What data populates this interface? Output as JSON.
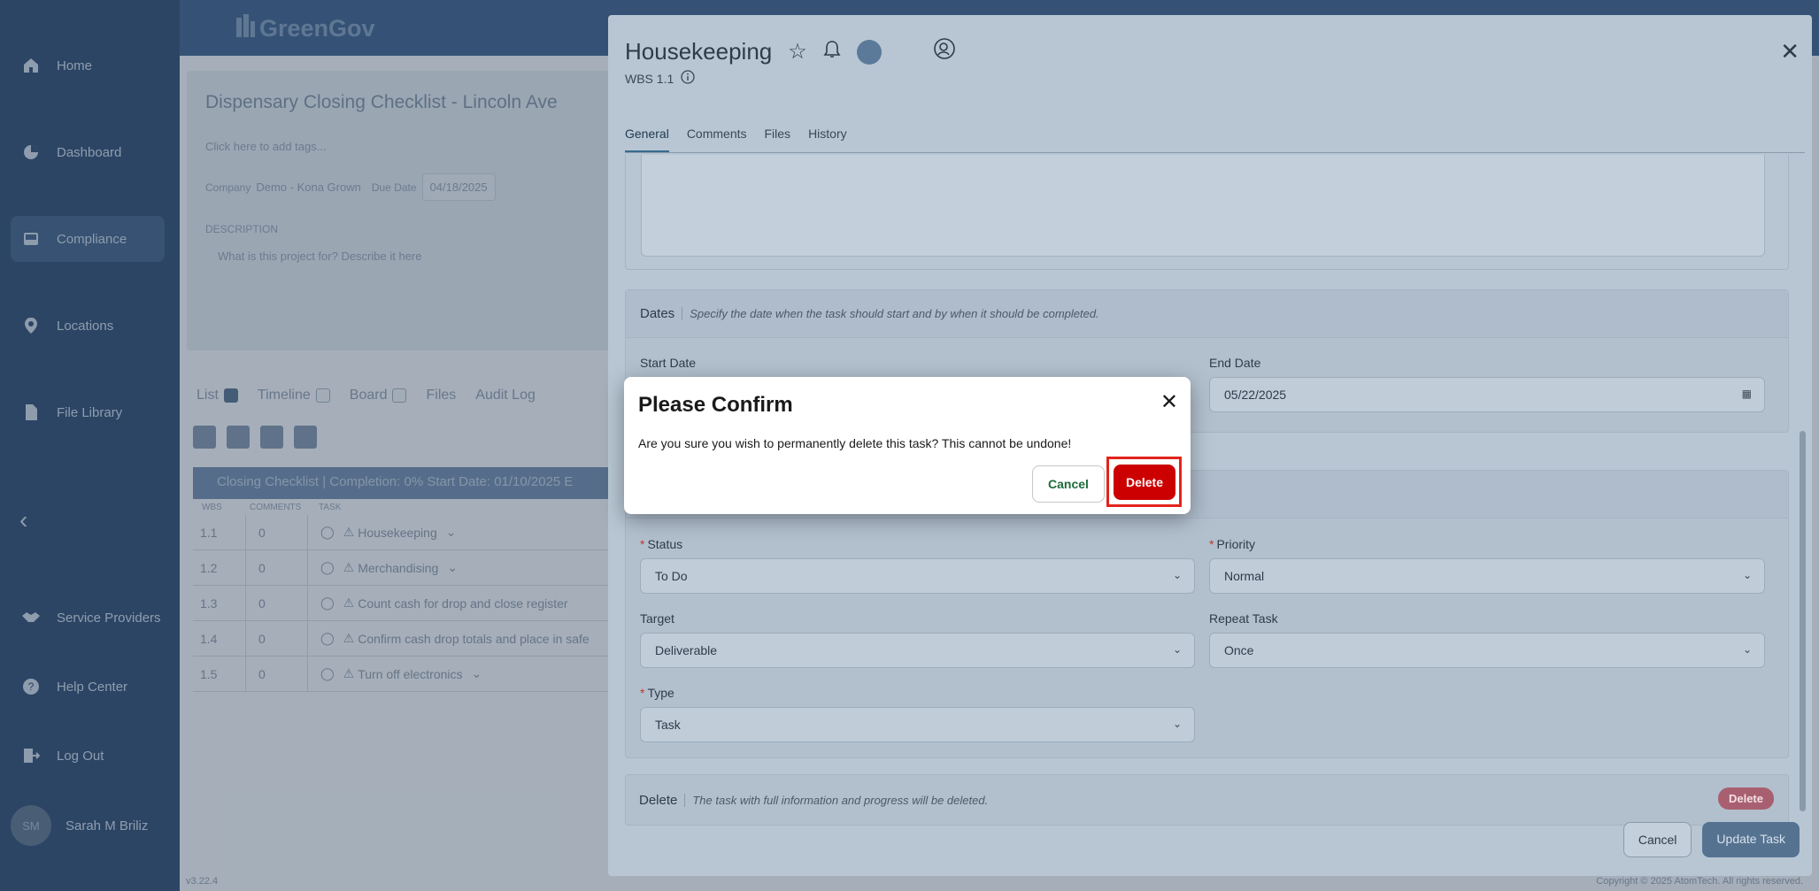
{
  "app": {
    "logo_text": "GreenGov"
  },
  "sidebar": {
    "items": [
      {
        "label": "Home"
      },
      {
        "label": "Dashboard"
      },
      {
        "label": "Compliance"
      },
      {
        "label": "Locations"
      },
      {
        "label": "File Library"
      },
      {
        "label": "Service Providers"
      },
      {
        "label": "Help Center"
      },
      {
        "label": "Log Out"
      }
    ],
    "user": {
      "initials": "SM",
      "name": "Sarah M Briliz"
    }
  },
  "project": {
    "title": "Dispensary Closing Checklist - Lincoln Ave",
    "tags_placeholder": "Click here to add tags...",
    "company_label": "Company",
    "company_value": "Demo - Kona Grown",
    "due_label": "Due Date",
    "due_value": "04/18/2025",
    "desc_label": "DESCRIPTION",
    "desc_placeholder": "What is this project for? Describe it here",
    "view_tabs": [
      "List",
      "Timeline",
      "Board",
      "Files",
      "Audit Log"
    ],
    "group_header": "Closing Checklist  |  Completion: 0%  Start Date: 01/10/2025  E",
    "columns": [
      "WBS",
      "COMMENTS",
      "TASK"
    ],
    "rows": [
      {
        "wbs": "1.1",
        "comments": "0",
        "task": "Housekeeping"
      },
      {
        "wbs": "1.2",
        "comments": "0",
        "task": "Merchandising"
      },
      {
        "wbs": "1.3",
        "comments": "0",
        "task": "Count cash for drop and close register"
      },
      {
        "wbs": "1.4",
        "comments": "0",
        "task": "Confirm cash drop totals and place in safe"
      },
      {
        "wbs": "1.5",
        "comments": "0",
        "task": "Turn off electronics"
      }
    ],
    "version": "v3.22.4",
    "copyright": "Copyright © 2025 AtomTech. All rights reserved."
  },
  "panel": {
    "title": "Housekeeping",
    "wbs": "WBS 1.1",
    "tabs": [
      "General",
      "Comments",
      "Files",
      "History"
    ],
    "dates": {
      "heading": "Dates",
      "subtitle": "Specify the date when the task should start and by when it should be completed.",
      "start_label": "Start Date",
      "end_label": "End Date",
      "end_value": "05/22/2025"
    },
    "fields": {
      "status_label": "Status",
      "status_value": "To Do",
      "priority_label": "Priority",
      "priority_value": "Normal",
      "target_label": "Target",
      "target_value": "Deliverable",
      "repeat_label": "Repeat Task",
      "repeat_value": "Once",
      "type_label": "Type",
      "type_value": "Task"
    },
    "delete_section": {
      "heading": "Delete",
      "subtitle": "The task with full information and progress will be deleted.",
      "button": "Delete"
    },
    "footer": {
      "cancel": "Cancel",
      "update": "Update Task"
    }
  },
  "modal": {
    "title": "Please Confirm",
    "message": "Are you sure you wish to permanently delete this task? This cannot be undone!",
    "cancel": "Cancel",
    "delete": "Delete"
  }
}
